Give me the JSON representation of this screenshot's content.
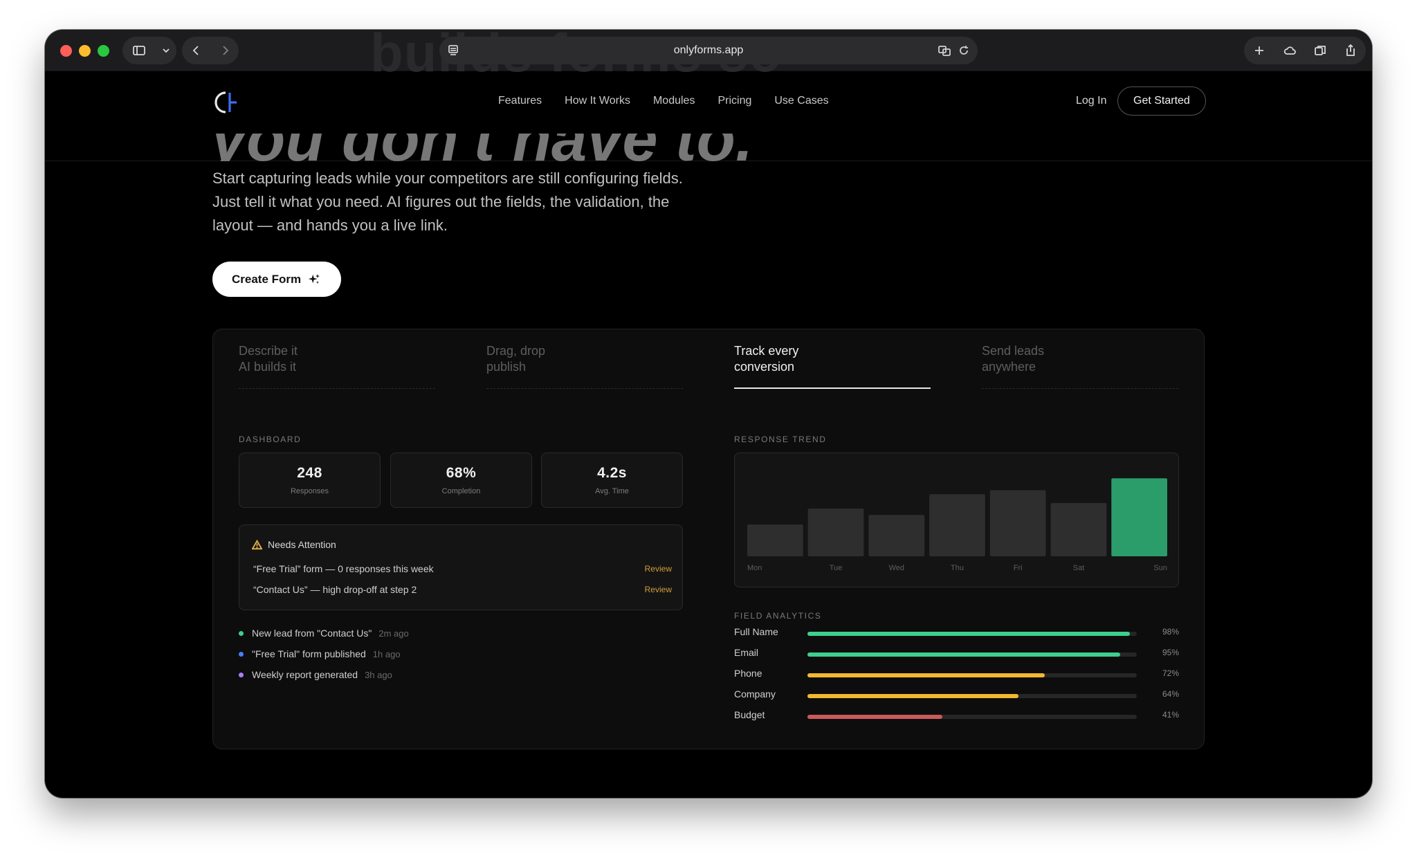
{
  "browser": {
    "url": "onlyforms.app",
    "ghost_heading": "builds forms so"
  },
  "nav": {
    "links": [
      "Features",
      "How It Works",
      "Modules",
      "Pricing",
      "Use Cases"
    ],
    "login": "Log In",
    "cta": "Get Started"
  },
  "hero": {
    "clipped_heading": "you don't have to.",
    "description": "Start capturing leads while your competitors are still configuring fields. Just tell it what you need. AI figures out the fields, the validation, the layout — and hands you a live link.",
    "cta": "Create Form"
  },
  "tabs": [
    {
      "line1": "Describe it",
      "line2": "AI builds it",
      "active": false
    },
    {
      "line1": "Drag, drop",
      "line2": "publish",
      "active": false
    },
    {
      "line1": "Track every",
      "line2": "conversion",
      "active": true
    },
    {
      "line1": "Send leads",
      "line2": "anywhere",
      "active": false
    }
  ],
  "dashboard": {
    "label": "DASHBOARD",
    "stats": [
      {
        "value": "248",
        "label": "Responses"
      },
      {
        "value": "68%",
        "label": "Completion"
      },
      {
        "value": "4.2s",
        "label": "Avg. Time"
      }
    ],
    "attention": {
      "title": "Needs Attention",
      "items": [
        {
          "text": "“Free Trial” form — 0 responses this week",
          "action": "Review"
        },
        {
          "text": "“Contact Us” — high drop-off at step 2",
          "action": "Review"
        }
      ]
    },
    "activity": [
      {
        "text": "New lead from \"Contact Us\"",
        "ago": "2m ago",
        "color": "#3ecf8e"
      },
      {
        "text": "\"Free Trial\" form published",
        "ago": "1h ago",
        "color": "#4a7dff"
      },
      {
        "text": "Weekly report generated",
        "ago": "3h ago",
        "color": "#b07cff"
      }
    ]
  },
  "trend": {
    "label": "RESPONSE TREND",
    "bar_color": "#2e2e2e",
    "highlight_color": "#2a9d6b"
  },
  "chart_data": {
    "type": "bar",
    "categories": [
      "Mon",
      "Tue",
      "Wed",
      "Thu",
      "Fri",
      "Sat",
      "Sun"
    ],
    "values": [
      40,
      60,
      52,
      78,
      83,
      67,
      98
    ],
    "ylim": [
      0,
      100
    ],
    "highlight_index": 6
  },
  "field_analytics": {
    "label": "FIELD ANALYTICS",
    "fields": [
      {
        "name": "Full Name",
        "pct_label": "98%",
        "value": 98,
        "color": "#3ecf8e"
      },
      {
        "name": "Email",
        "pct_label": "95%",
        "value": 95,
        "color": "#3ecf8e"
      },
      {
        "name": "Phone",
        "pct_label": "72%",
        "value": 72,
        "color": "#f2b92e"
      },
      {
        "name": "Company",
        "pct_label": "64%",
        "value": 64,
        "color": "#f2b92e"
      },
      {
        "name": "Budget",
        "pct_label": "41%",
        "value": 41,
        "color": "#c95a5a"
      }
    ]
  }
}
